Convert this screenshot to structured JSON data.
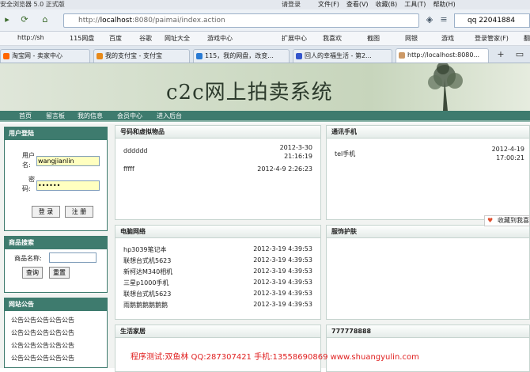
{
  "browser": {
    "title": "安全浏览器 5.0 正式版",
    "login": "请登录",
    "menus": [
      "文件(F)",
      "查看(V)",
      "收藏(B)",
      "工具(T)",
      "帮助(H)"
    ],
    "url_prefix": "http://",
    "url_host": "localhost",
    "url_rest": ":8080/paimai/index.action",
    "search_value": "qq 22041884",
    "favorites": [
      "http://sh",
      "115网盘",
      "百度",
      "谷歌",
      "网址大全",
      "游戏中心",
      "扩展中心",
      "我喜欢",
      "截图",
      "网银",
      "游戏",
      "登录管家(F)",
      "翻"
    ],
    "tabs": [
      "淘宝网 - 卖家中心",
      "我的支付宝 - 支付宝",
      "115，我的网盘，改变...",
      "回人的幸福生活 - 第2...",
      "http://localhost:8080..."
    ]
  },
  "site": {
    "title": "c2c网上拍卖系统",
    "nav": [
      "首页",
      "留言板",
      "我的信息",
      "会员中心",
      "进入后台"
    ]
  },
  "login": {
    "header": "用户登陆",
    "username_label_1": "用户",
    "username_label_2": "名:",
    "username_value": "wangjianlin",
    "password_label_1": "密",
    "password_label_2": "码:",
    "password_value": "••••••",
    "login_button": "登 录",
    "register_button": "注 册"
  },
  "search": {
    "header": "商品搜索",
    "name_label": "商品名称:",
    "query_button": "查询",
    "reset_button": "重置"
  },
  "notice": {
    "header": "网站公告",
    "items": [
      "公告公告公告公告公告",
      "公告公告公告公告公告",
      "公告公告公告公告公告",
      "公告公告公告公告公告"
    ]
  },
  "panels": {
    "virtual": {
      "header": "号码和虚拟物品",
      "items": [
        {
          "name": "dddddd",
          "date": "2012-3-30",
          "time": "21:16:19"
        },
        {
          "name": "fffff",
          "date": "2012-4-9 2:26:23"
        }
      ]
    },
    "phones": {
      "header": "通讯手机",
      "items": [
        {
          "name": "tel手机",
          "date": "2012-4-19",
          "time": "17:00:21"
        }
      ]
    },
    "computers": {
      "header": "电脑网络",
      "items": [
        {
          "name": "hp3039笔记本",
          "date": "2012-3-19 4:39:53"
        },
        {
          "name": "联想台式机5623",
          "date": "2012-3-19 4:39:53"
        },
        {
          "name": "新柯达M340相机",
          "date": "2012-3-19 4:39:53"
        },
        {
          "name": "三星p1000手机",
          "date": "2012-3-19 4:39:53"
        },
        {
          "name": "联想台式机5623",
          "date": "2012-3-19 4:39:53"
        },
        {
          "name": "雨鹅鹅鹅鹅鹅鹅",
          "date": "2012-3-19 4:39:53"
        }
      ]
    },
    "clothing": {
      "header": "服饰护肤"
    },
    "home": {
      "header": "生活家居"
    },
    "other": {
      "header": "777778888"
    }
  },
  "footer": "程序测试:双鱼林 QQ:287307421 手机:13558690869 www.shuangyulin.com",
  "collect": "收藏到我喜",
  "colors": {
    "nav": "#3e7b6e",
    "footer": "#e02020"
  }
}
